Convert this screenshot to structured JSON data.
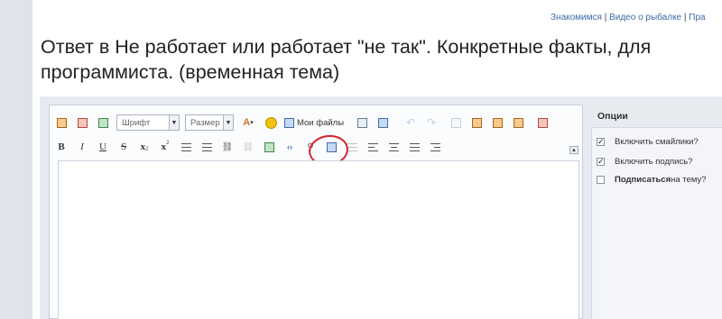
{
  "top_links": {
    "link1": "Знакомимся",
    "sep1": " | ",
    "link2": "Видео о рыбалке",
    "sep2": " | ",
    "link3": "Пра"
  },
  "page": {
    "title": "Ответ в Не работает или работает \"не так\". Конкретные факты, для программиста. (временная тема)"
  },
  "toolbar": {
    "font_select": "Шрифт",
    "size_select": "Размер",
    "my_files": "Мои файлы",
    "bold": "B",
    "italic": "I",
    "underline": "U",
    "strike": "S",
    "subscript": "x",
    "superscript": "x",
    "sub_mark": "2",
    "sup_mark": "2"
  },
  "options": {
    "header": "Опции",
    "enable_smilies": "Включить смайлики?",
    "enable_signature": "Включить подпись?",
    "subscribe_bold": "Подписаться",
    "subscribe_rest": " на тему?"
  },
  "colors": {
    "accent_link": "#3a6aa5",
    "highlight": "#d9232a",
    "panel_bg": "#e7ebf1"
  }
}
